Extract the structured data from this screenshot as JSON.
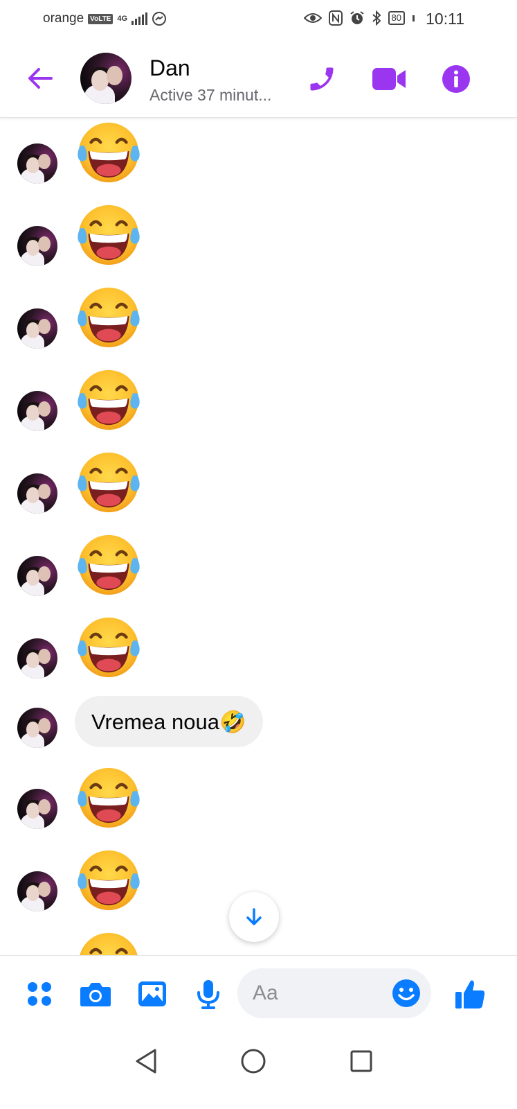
{
  "status_bar": {
    "carrier": "orange",
    "volte": "VoLTE",
    "network": "4G",
    "battery": "80",
    "time": "10:11"
  },
  "header": {
    "contact_name": "Dan",
    "status": "Active 37 minut..."
  },
  "messages": [
    {
      "type": "emoji",
      "emoji": "face-with-tears-of-joy"
    },
    {
      "type": "emoji",
      "emoji": "face-with-tears-of-joy"
    },
    {
      "type": "emoji",
      "emoji": "face-with-tears-of-joy"
    },
    {
      "type": "emoji",
      "emoji": "face-with-tears-of-joy"
    },
    {
      "type": "emoji",
      "emoji": "face-with-tears-of-joy"
    },
    {
      "type": "emoji",
      "emoji": "face-with-tears-of-joy"
    },
    {
      "type": "emoji",
      "emoji": "face-with-tears-of-joy"
    },
    {
      "type": "text",
      "text": "Vremea noua🤣"
    },
    {
      "type": "emoji",
      "emoji": "face-with-tears-of-joy"
    },
    {
      "type": "emoji",
      "emoji": "face-with-tears-of-joy"
    },
    {
      "type": "emoji",
      "emoji": "face-with-tears-of-joy"
    }
  ],
  "composer": {
    "placeholder": "Aa"
  },
  "colors": {
    "header_accent": "#9b36f0",
    "composer_accent": "#0a7cff",
    "bubble_bg": "#f0f0f0"
  }
}
